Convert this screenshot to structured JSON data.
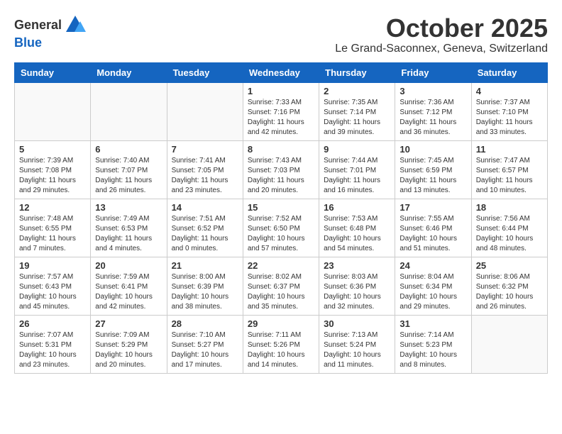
{
  "header": {
    "logo_general": "General",
    "logo_blue": "Blue",
    "month": "October 2025",
    "location": "Le Grand-Saconnex, Geneva, Switzerland"
  },
  "weekdays": [
    "Sunday",
    "Monday",
    "Tuesday",
    "Wednesday",
    "Thursday",
    "Friday",
    "Saturday"
  ],
  "weeks": [
    [
      {
        "day": "",
        "sunrise": "",
        "sunset": "",
        "daylight": ""
      },
      {
        "day": "",
        "sunrise": "",
        "sunset": "",
        "daylight": ""
      },
      {
        "day": "",
        "sunrise": "",
        "sunset": "",
        "daylight": ""
      },
      {
        "day": "1",
        "sunrise": "Sunrise: 7:33 AM",
        "sunset": "Sunset: 7:16 PM",
        "daylight": "Daylight: 11 hours and 42 minutes."
      },
      {
        "day": "2",
        "sunrise": "Sunrise: 7:35 AM",
        "sunset": "Sunset: 7:14 PM",
        "daylight": "Daylight: 11 hours and 39 minutes."
      },
      {
        "day": "3",
        "sunrise": "Sunrise: 7:36 AM",
        "sunset": "Sunset: 7:12 PM",
        "daylight": "Daylight: 11 hours and 36 minutes."
      },
      {
        "day": "4",
        "sunrise": "Sunrise: 7:37 AM",
        "sunset": "Sunset: 7:10 PM",
        "daylight": "Daylight: 11 hours and 33 minutes."
      }
    ],
    [
      {
        "day": "5",
        "sunrise": "Sunrise: 7:39 AM",
        "sunset": "Sunset: 7:08 PM",
        "daylight": "Daylight: 11 hours and 29 minutes."
      },
      {
        "day": "6",
        "sunrise": "Sunrise: 7:40 AM",
        "sunset": "Sunset: 7:07 PM",
        "daylight": "Daylight: 11 hours and 26 minutes."
      },
      {
        "day": "7",
        "sunrise": "Sunrise: 7:41 AM",
        "sunset": "Sunset: 7:05 PM",
        "daylight": "Daylight: 11 hours and 23 minutes."
      },
      {
        "day": "8",
        "sunrise": "Sunrise: 7:43 AM",
        "sunset": "Sunset: 7:03 PM",
        "daylight": "Daylight: 11 hours and 20 minutes."
      },
      {
        "day": "9",
        "sunrise": "Sunrise: 7:44 AM",
        "sunset": "Sunset: 7:01 PM",
        "daylight": "Daylight: 11 hours and 16 minutes."
      },
      {
        "day": "10",
        "sunrise": "Sunrise: 7:45 AM",
        "sunset": "Sunset: 6:59 PM",
        "daylight": "Daylight: 11 hours and 13 minutes."
      },
      {
        "day": "11",
        "sunrise": "Sunrise: 7:47 AM",
        "sunset": "Sunset: 6:57 PM",
        "daylight": "Daylight: 11 hours and 10 minutes."
      }
    ],
    [
      {
        "day": "12",
        "sunrise": "Sunrise: 7:48 AM",
        "sunset": "Sunset: 6:55 PM",
        "daylight": "Daylight: 11 hours and 7 minutes."
      },
      {
        "day": "13",
        "sunrise": "Sunrise: 7:49 AM",
        "sunset": "Sunset: 6:53 PM",
        "daylight": "Daylight: 11 hours and 4 minutes."
      },
      {
        "day": "14",
        "sunrise": "Sunrise: 7:51 AM",
        "sunset": "Sunset: 6:52 PM",
        "daylight": "Daylight: 11 hours and 0 minutes."
      },
      {
        "day": "15",
        "sunrise": "Sunrise: 7:52 AM",
        "sunset": "Sunset: 6:50 PM",
        "daylight": "Daylight: 10 hours and 57 minutes."
      },
      {
        "day": "16",
        "sunrise": "Sunrise: 7:53 AM",
        "sunset": "Sunset: 6:48 PM",
        "daylight": "Daylight: 10 hours and 54 minutes."
      },
      {
        "day": "17",
        "sunrise": "Sunrise: 7:55 AM",
        "sunset": "Sunset: 6:46 PM",
        "daylight": "Daylight: 10 hours and 51 minutes."
      },
      {
        "day": "18",
        "sunrise": "Sunrise: 7:56 AM",
        "sunset": "Sunset: 6:44 PM",
        "daylight": "Daylight: 10 hours and 48 minutes."
      }
    ],
    [
      {
        "day": "19",
        "sunrise": "Sunrise: 7:57 AM",
        "sunset": "Sunset: 6:43 PM",
        "daylight": "Daylight: 10 hours and 45 minutes."
      },
      {
        "day": "20",
        "sunrise": "Sunrise: 7:59 AM",
        "sunset": "Sunset: 6:41 PM",
        "daylight": "Daylight: 10 hours and 42 minutes."
      },
      {
        "day": "21",
        "sunrise": "Sunrise: 8:00 AM",
        "sunset": "Sunset: 6:39 PM",
        "daylight": "Daylight: 10 hours and 38 minutes."
      },
      {
        "day": "22",
        "sunrise": "Sunrise: 8:02 AM",
        "sunset": "Sunset: 6:37 PM",
        "daylight": "Daylight: 10 hours and 35 minutes."
      },
      {
        "day": "23",
        "sunrise": "Sunrise: 8:03 AM",
        "sunset": "Sunset: 6:36 PM",
        "daylight": "Daylight: 10 hours and 32 minutes."
      },
      {
        "day": "24",
        "sunrise": "Sunrise: 8:04 AM",
        "sunset": "Sunset: 6:34 PM",
        "daylight": "Daylight: 10 hours and 29 minutes."
      },
      {
        "day": "25",
        "sunrise": "Sunrise: 8:06 AM",
        "sunset": "Sunset: 6:32 PM",
        "daylight": "Daylight: 10 hours and 26 minutes."
      }
    ],
    [
      {
        "day": "26",
        "sunrise": "Sunrise: 7:07 AM",
        "sunset": "Sunset: 5:31 PM",
        "daylight": "Daylight: 10 hours and 23 minutes."
      },
      {
        "day": "27",
        "sunrise": "Sunrise: 7:09 AM",
        "sunset": "Sunset: 5:29 PM",
        "daylight": "Daylight: 10 hours and 20 minutes."
      },
      {
        "day": "28",
        "sunrise": "Sunrise: 7:10 AM",
        "sunset": "Sunset: 5:27 PM",
        "daylight": "Daylight: 10 hours and 17 minutes."
      },
      {
        "day": "29",
        "sunrise": "Sunrise: 7:11 AM",
        "sunset": "Sunset: 5:26 PM",
        "daylight": "Daylight: 10 hours and 14 minutes."
      },
      {
        "day": "30",
        "sunrise": "Sunrise: 7:13 AM",
        "sunset": "Sunset: 5:24 PM",
        "daylight": "Daylight: 10 hours and 11 minutes."
      },
      {
        "day": "31",
        "sunrise": "Sunrise: 7:14 AM",
        "sunset": "Sunset: 5:23 PM",
        "daylight": "Daylight: 10 hours and 8 minutes."
      },
      {
        "day": "",
        "sunrise": "",
        "sunset": "",
        "daylight": ""
      }
    ]
  ]
}
